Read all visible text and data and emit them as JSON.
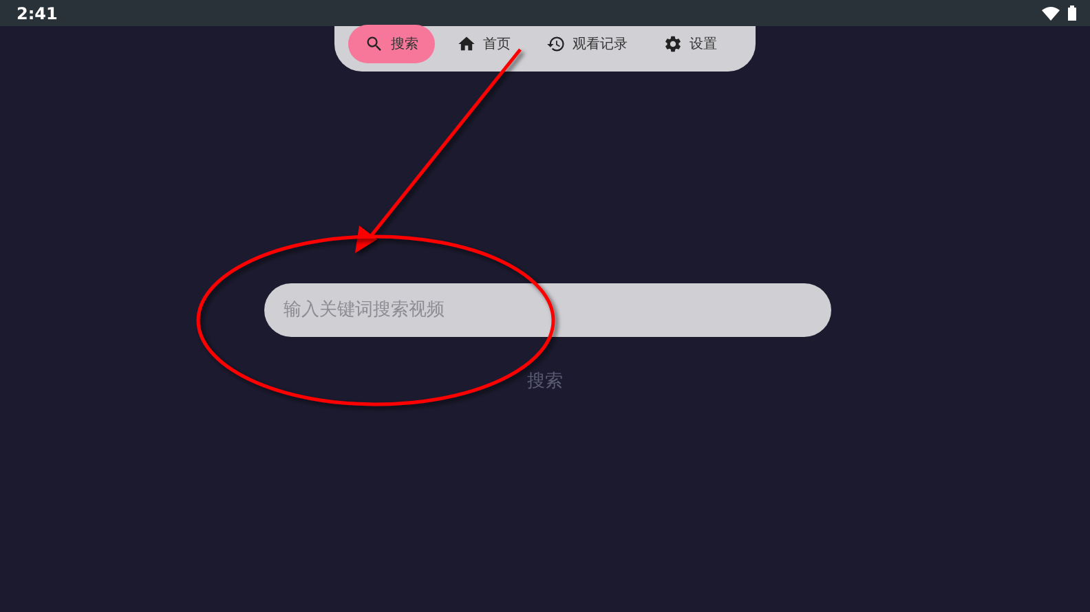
{
  "status_bar": {
    "time": "2:41"
  },
  "nav": {
    "tabs": [
      {
        "kind": "search",
        "label": "搜索",
        "selected": true
      },
      {
        "kind": "home",
        "label": "首页",
        "selected": false
      },
      {
        "kind": "history",
        "label": "观看记录",
        "selected": false
      },
      {
        "kind": "settings",
        "label": "设置",
        "selected": false
      }
    ]
  },
  "search": {
    "placeholder": "输入关键词搜索视频",
    "button": "搜索"
  }
}
